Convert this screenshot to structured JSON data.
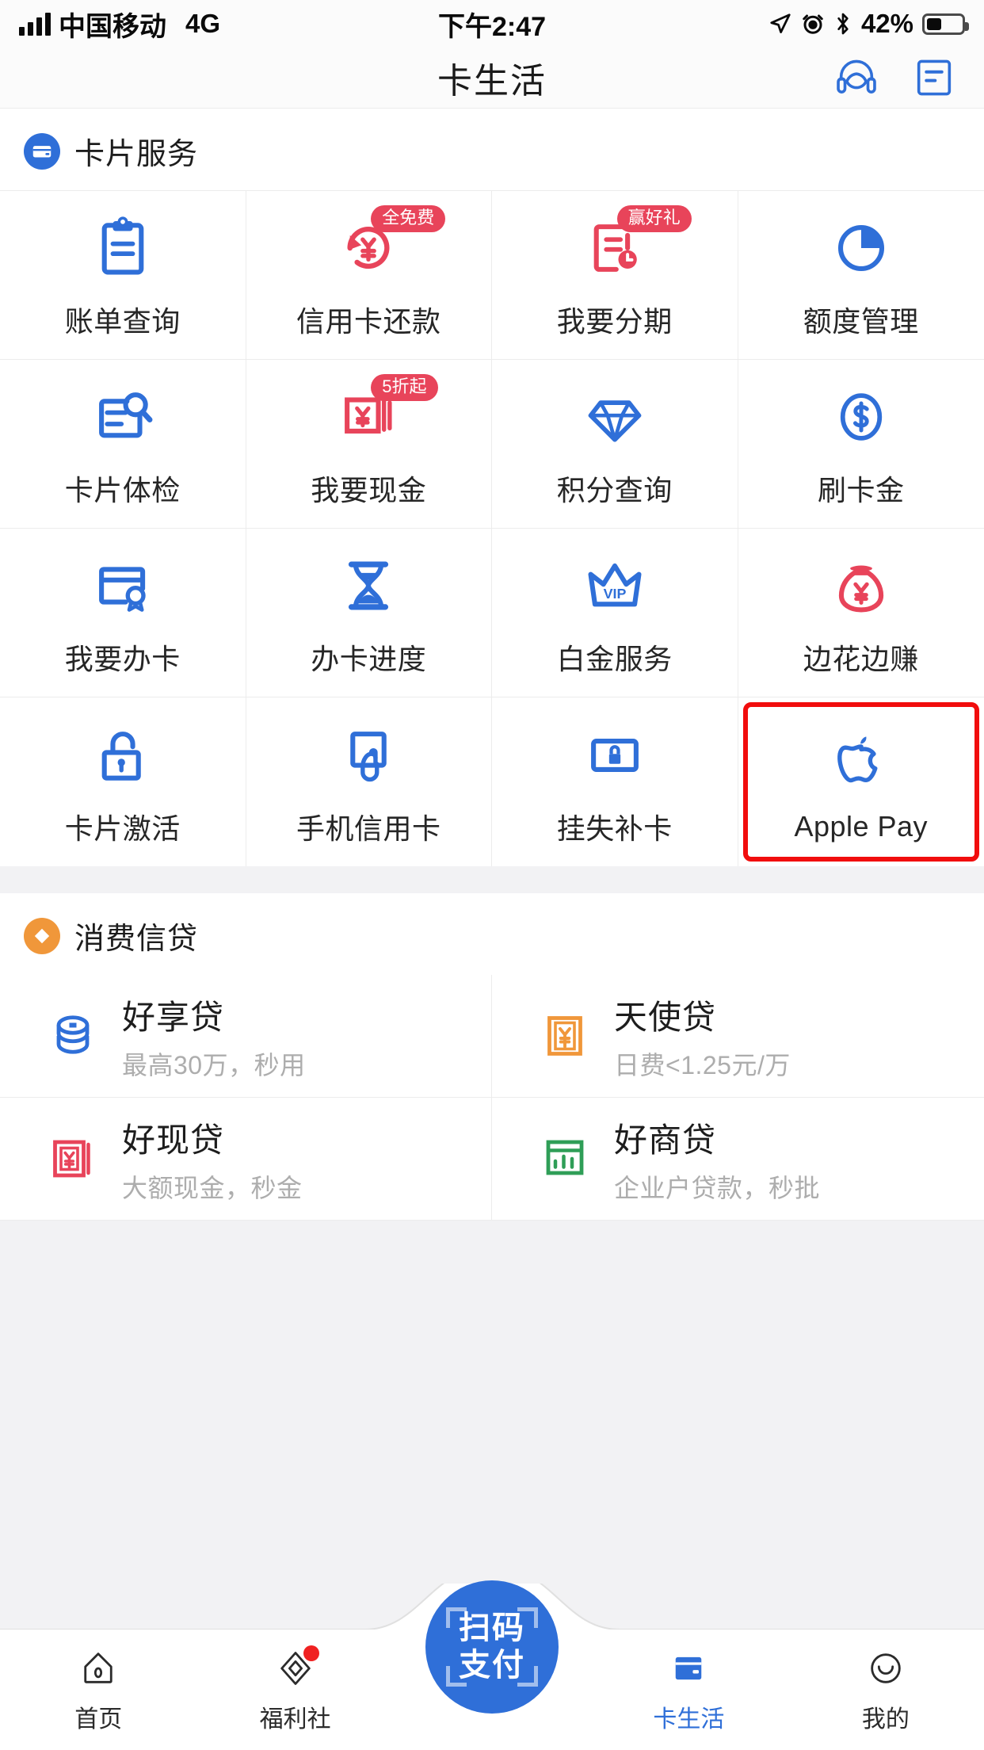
{
  "status_bar": {
    "carrier": "中国移动",
    "network": "4G",
    "time": "下午2:47",
    "battery_percent": "42%",
    "battery_level": 42,
    "icons": [
      "signal-icon",
      "location-arrow-icon",
      "alarm-clock-icon",
      "bluetooth-icon",
      "battery-icon"
    ]
  },
  "header": {
    "title": "卡生活",
    "actions": [
      {
        "name": "customer-service-icon",
        "label": "在线客服"
      },
      {
        "name": "message-icon",
        "label": "消息"
      }
    ]
  },
  "sections": [
    {
      "id": "card-services",
      "title": "卡片服务",
      "badge_icon": "credit-card-icon",
      "badge_color": "#2f6fd8",
      "items": [
        {
          "label": "账单查询",
          "icon": "clipboard-icon",
          "color": "#2f6fd8",
          "badge": ""
        },
        {
          "label": "信用卡还款",
          "icon": "refresh-yuan-icon",
          "color": "#e8445a",
          "badge": "全免费"
        },
        {
          "label": "我要分期",
          "icon": "document-clock-icon",
          "color": "#e8445a",
          "badge": "赢好礼"
        },
        {
          "label": "额度管理",
          "icon": "pie-chart-icon",
          "color": "#2f6fd8",
          "badge": ""
        },
        {
          "label": "卡片体检",
          "icon": "card-search-icon",
          "color": "#2f6fd8",
          "badge": ""
        },
        {
          "label": "我要现金",
          "icon": "cash-yuan-icon",
          "color": "#e8445a",
          "badge": "5折起"
        },
        {
          "label": "积分查询",
          "icon": "diamond-icon",
          "color": "#2f6fd8",
          "badge": ""
        },
        {
          "label": "刷卡金",
          "icon": "dollar-circle-icon",
          "color": "#2f6fd8",
          "badge": ""
        },
        {
          "label": "我要办卡",
          "icon": "card-badge-icon",
          "color": "#2f6fd8",
          "badge": ""
        },
        {
          "label": "办卡进度",
          "icon": "hourglass-icon",
          "color": "#2f6fd8",
          "badge": ""
        },
        {
          "label": "白金服务",
          "icon": "vip-crown-icon",
          "color": "#2f6fd8",
          "badge": ""
        },
        {
          "label": "边花边赚",
          "icon": "money-bag-yuan-icon",
          "color": "#e8445a",
          "badge": ""
        },
        {
          "label": "卡片激活",
          "icon": "unlock-icon",
          "color": "#2f6fd8",
          "badge": ""
        },
        {
          "label": "手机信用卡",
          "icon": "phone-tap-icon",
          "color": "#2f6fd8",
          "badge": ""
        },
        {
          "label": "挂失补卡",
          "icon": "lock-card-icon",
          "color": "#2f6fd8",
          "badge": ""
        },
        {
          "label": "Apple Pay",
          "icon": "apple-icon",
          "color": "#2f6fd8",
          "badge": "",
          "highlighted": true
        }
      ]
    },
    {
      "id": "consumer-credit",
      "title": "消费信贷",
      "badge_icon": "diamond-icon",
      "badge_color": "#f0973a",
      "items": [
        {
          "name": "好享贷",
          "desc": "最高30万，秒用",
          "icon": "coin-stack-icon",
          "color": "#2f6fd8"
        },
        {
          "name": "天使贷",
          "desc": "日费<1.25元/万",
          "icon": "banknote-icon",
          "color": "#f0973a"
        },
        {
          "name": "好现贷",
          "desc": "大额现金，秒金",
          "icon": "banknote-red-icon",
          "color": "#e8445a"
        },
        {
          "name": "好商贷",
          "desc": "企业户贷款，秒批",
          "icon": "chart-note-icon",
          "color": "#2f9e57"
        }
      ]
    }
  ],
  "tabbar": {
    "items": [
      {
        "label": "首页",
        "icon": "home-icon",
        "active": false,
        "dot": false
      },
      {
        "label": "福利社",
        "icon": "gift-icon",
        "active": false,
        "dot": true
      },
      {
        "label": "卡生活",
        "icon": "card-icon",
        "active": true,
        "dot": false
      },
      {
        "label": "我的",
        "icon": "smiley-icon",
        "active": false,
        "dot": false
      }
    ],
    "scan_button": {
      "line1": "扫码",
      "line2": "支付",
      "color": "#2f6fd8"
    }
  },
  "colors": {
    "primary": "#2f6fd8",
    "red": "#e8445a",
    "orange": "#f0973a",
    "green": "#2f9e57",
    "highlight": "#f10d0d"
  }
}
